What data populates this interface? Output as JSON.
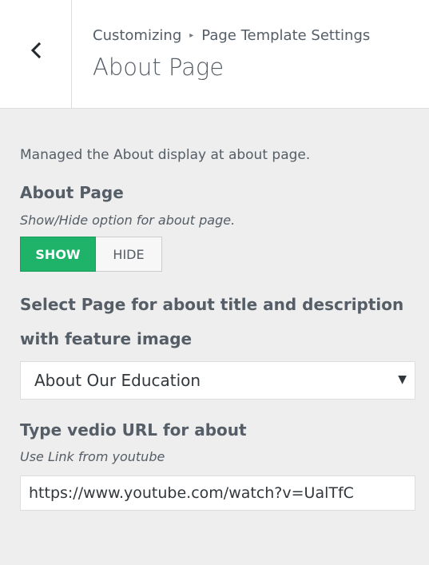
{
  "header": {
    "breadcrumb_root": "Customizing",
    "breadcrumb_separator": "▸",
    "breadcrumb_section": "Page Template Settings",
    "title": "About Page",
    "back_icon": "chevron-left-icon"
  },
  "content": {
    "description": "Managed the About display at about page.",
    "about_section": {
      "label": "About Page",
      "hint": "Show/Hide option for about page.",
      "toggle": {
        "options": [
          "SHOW",
          "HIDE"
        ],
        "selected": "SHOW",
        "active_color": "#1fb269"
      }
    },
    "select_section": {
      "label": "Select Page for about title and description with feature image",
      "selected_value": "About Our Education",
      "caret": "▼"
    },
    "video_section": {
      "label": "Type vedio URL for about",
      "hint": "Use Link from youtube",
      "value": "https://www.youtube.com/watch?v=UalTfC"
    }
  }
}
